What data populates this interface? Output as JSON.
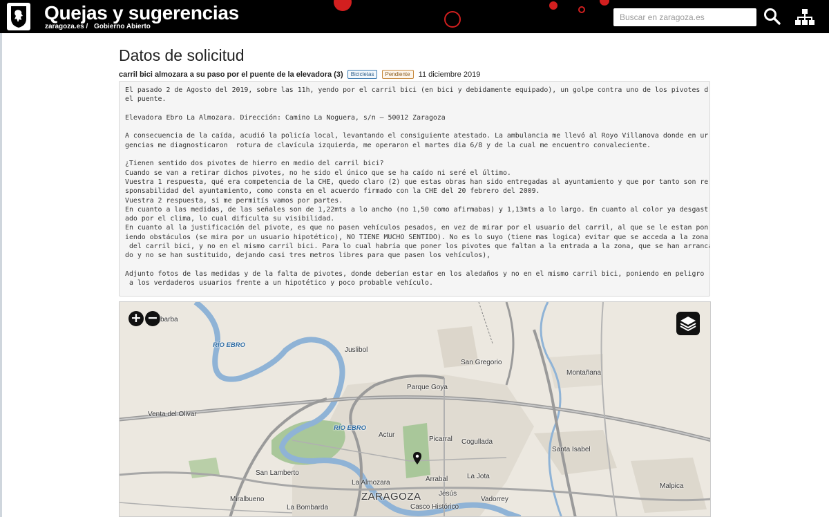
{
  "header": {
    "title": "Quejas y sugerencias",
    "breadcrumb": [
      "zaragoza.es /",
      "Gobierno Abierto"
    ],
    "search_placeholder": "Buscar en zaragoza.es",
    "brand_color": "#000000"
  },
  "request": {
    "heading": "Datos de solicitud",
    "subject": "carril bici almozara a su paso por el puente de la elevadora (3)",
    "badges": {
      "category": "Bicicletas",
      "status": "Pendiente"
    },
    "date": "11 diciembre 2019",
    "body": "El pasado 2 de Agosto del 2019, sobre las 11h, yendo por el carril bici (en bici y debidamente equipado), un golpe contra uno de los pivotes d\nel puente.\n\nElevadora Ebro La Almozara. Dirección: Camino La Noguera, s/n — 50012 Zaragoza\n\nA consecuencia de la caída, acudió la policía local, levantando el consiguiente atestado. La ambulancia me llevó al Royo Villanova donde en ur\ngencias me diagnosticaron  rotura de clavícula izquierda, me operaron el martes dia 6/8 y de la cual me encuentro convaleciente.\n\n¿Tienen sentido dos pivotes de hierro en medio del carril bici?\nCuando se van a retirar dichos pivotes, no he sido el único que se ha caído ni seré el último.\nVuestra 1 respuesta, qué era competencia de la CHE, quedo claro (2) que estas obras han sido entregadas al ayuntamiento y que por tanto son re\nsponsabilidad del ayuntamiento, como consta en el acuerdo firmado con la CHE del 20 febrero del 2009.\nVuestra 2 respuesta, si me permitís vamos por partes.\nEn cuanto a las medidas, de las señales son de 1,22mts a lo ancho (no 1,50 como afirmabas) y 1,13mts a lo largo. En cuanto al color ya desgast\nado por el clima, lo cual dificulta su visibilidad.\nEn cuanto al la justificación del pivote, es que no pasen vehículos pesados, en vez de mirar por el usuario del carril, al que se le estan pon\niendo obstáculos (se mira por un usuario hipotético), NO TIENE MUCHO SENTIDO). No es lo suyo (tiene mas logica) evitar que se acceda a la zona\n del carril bici, y no en el mismo carril bici. Para lo cual habría que poner los pivotes que faltan a la entrada a la zona, que se han arranca\ndo y no se han sustituido, dejando casi tres metros libres para que pasen los vehículos),\n\nAdjunto fotos de las medidas y de la falta de pivotes, donde deberían estar en los aledaños y no en el mismo carril bici, poniendo en peligro\n a los verdaderos usuarios frente a un hipotético y poco probable vehículo."
  },
  "map": {
    "zoom_in": "+",
    "zoom_out": "−",
    "labels": {
      "barba": "barba",
      "rio_ebro_1": "RÍO EBRO",
      "juslibol": "Juslibol",
      "san_gregorio": "San Gregorio",
      "montanana": "Montañana",
      "parque_goya": "Parque Goya",
      "venta_del_olivar": "Venta del Olivar",
      "rio_ebro_2": "RÍO EBRO",
      "actur": "Actur",
      "picarral": "Picarral",
      "cogullada": "Cogullada",
      "santa_isabel": "Santa Isabel",
      "san_lamberto": "San Lamberto",
      "arrabal": "Arrabal",
      "la_jota": "La Jota",
      "la_almozara": "La Almozara",
      "malpica": "Malpica",
      "miralbueno": "Miralbueno",
      "zaragoza": "ZARAGOZA",
      "jesus": "Jesús",
      "vadorrey": "Vadorrey",
      "la_bombarda": "La Bombarda",
      "casco_historico": "Casco Histórico"
    },
    "river_color": "#8fb3d6",
    "park_color": "#a9c79a"
  }
}
